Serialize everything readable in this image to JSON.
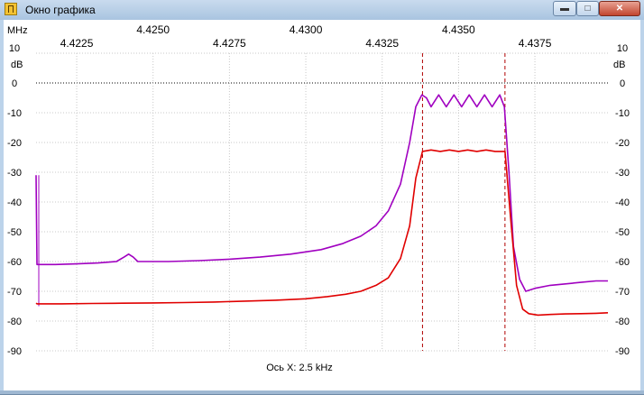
{
  "window": {
    "title": "Окно графика",
    "minimize_icon": "minimize-icon",
    "maximize_icon": "maximize-icon",
    "close_icon": "close-icon"
  },
  "chart_data": {
    "type": "line",
    "unit_label_x": "MHz",
    "unit_label_y": "dB",
    "x_top_ticks": [
      "4.4250",
      "4.4300",
      "4.4350"
    ],
    "x_bottom_ticks": [
      "4.4225",
      "4.4275",
      "4.4325",
      "4.4375"
    ],
    "xlim": [
      4.42117,
      4.43989
    ],
    "ylim": [
      -90,
      10
    ],
    "y_ticks": [
      10,
      0,
      -10,
      -20,
      -30,
      -40,
      -50,
      -60,
      -70,
      -80,
      -90
    ],
    "x_axis_note": "Ось X: 2.5 kHz",
    "zero_line": 0,
    "markers_x": [
      4.43382,
      4.43652
    ],
    "grid": true,
    "colors": {
      "series1": "#a000c0",
      "series2": "#e00000",
      "markers": "#b00000",
      "grid": "#c8c8c8"
    },
    "series": [
      {
        "color": "#a000c0",
        "x": [
          4.42117,
          4.4212,
          4.4218,
          4.4225,
          4.4232,
          4.4238,
          4.42405,
          4.4242,
          4.42435,
          4.4245,
          4.4255,
          4.4265,
          4.4275,
          4.4285,
          4.4295,
          4.4305,
          4.4312,
          4.4318,
          4.4323,
          4.4327,
          4.4331,
          4.4334,
          4.4336,
          4.4338,
          4.43395,
          4.4341,
          4.43435,
          4.4346,
          4.43485,
          4.4351,
          4.43535,
          4.4356,
          4.43585,
          4.4361,
          4.43635,
          4.4365,
          4.43665,
          4.4368,
          4.437,
          4.4372,
          4.4375,
          4.438,
          4.4385,
          4.439,
          4.4395,
          4.43989
        ],
        "y": [
          -31,
          -61,
          -61,
          -60.8,
          -60.5,
          -60,
          -58.5,
          -57.5,
          -58.5,
          -60,
          -60,
          -59.7,
          -59.2,
          -58.5,
          -57.5,
          -56,
          -54,
          -51.5,
          -48,
          -43,
          -34,
          -20,
          -8,
          -4,
          -5,
          -8,
          -4,
          -8,
          -4,
          -8,
          -4,
          -8,
          -4,
          -8,
          -4,
          -8,
          -30,
          -55,
          -66,
          -70,
          -69,
          -68,
          -67.5,
          -67,
          -66.5,
          -66.5
        ]
      },
      {
        "color": "#e00000",
        "x": [
          4.42117,
          4.4212,
          4.422,
          4.423,
          4.424,
          4.425,
          4.426,
          4.427,
          4.428,
          4.429,
          4.43,
          4.4307,
          4.4313,
          4.4318,
          4.4323,
          4.4327,
          4.4331,
          4.4334,
          4.4336,
          4.43382,
          4.4341,
          4.4344,
          4.4347,
          4.435,
          4.4353,
          4.4356,
          4.4359,
          4.4362,
          4.43652,
          4.4367,
          4.4369,
          4.4371,
          4.4373,
          4.4376,
          4.438,
          4.4385,
          4.439,
          4.4395,
          4.43989
        ],
        "y": [
          -74,
          -74.2,
          -74.2,
          -74.1,
          -74,
          -73.9,
          -73.8,
          -73.6,
          -73.3,
          -73,
          -72.5,
          -71.8,
          -71,
          -70,
          -68,
          -65.5,
          -59,
          -48,
          -32,
          -23,
          -22.5,
          -23,
          -22.5,
          -23,
          -22.5,
          -23,
          -22.5,
          -23,
          -23,
          -45,
          -68,
          -76,
          -77.5,
          -78,
          -77.8,
          -77.6,
          -77.5,
          -77.4,
          -77.2
        ]
      }
    ]
  }
}
